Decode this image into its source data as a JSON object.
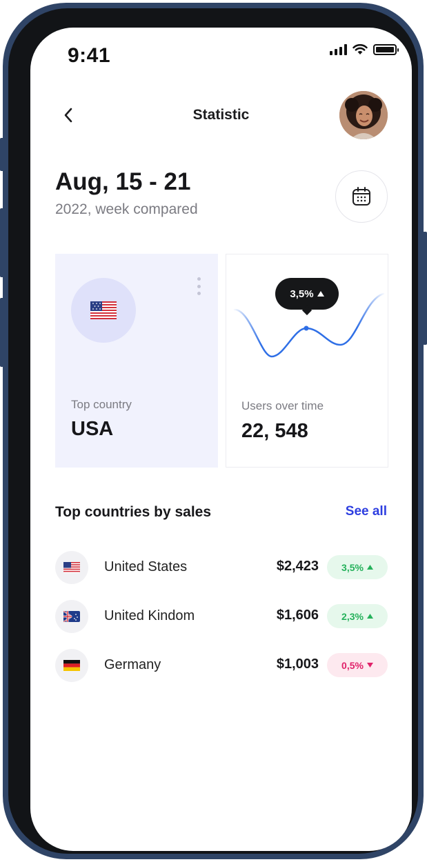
{
  "status_bar": {
    "time": "9:41"
  },
  "header": {
    "title": "Statistic"
  },
  "date": {
    "range": "Aug, 15 - 21",
    "subtitle": "2022, week compared"
  },
  "cards": {
    "top_country": {
      "label": "Top country",
      "value": "USA",
      "flag": "us-flag-icon"
    },
    "users": {
      "label": "Users over time",
      "value": "22, 548",
      "tooltip": "3,5%",
      "tooltip_trend": "up",
      "line_color": "#2f6fe6"
    }
  },
  "section": {
    "title": "Top countries by sales",
    "see_all": "See all"
  },
  "countries": [
    {
      "name": "United States",
      "amount": "$2,423",
      "change": "3,5%",
      "trend": "up",
      "flag": "us-flag-icon"
    },
    {
      "name": "United Kindom",
      "amount": "$1,606",
      "change": "2,3%",
      "trend": "up",
      "flag": "uk-flag-icon"
    },
    {
      "name": "Germany",
      "amount": "$1,003",
      "change": "0,5%",
      "trend": "down",
      "flag": "germany-flag-icon"
    }
  ],
  "colors": {
    "accent": "#2d3ee0",
    "positive": "#25b15b",
    "negative": "#e0226a",
    "card_bg": "#f1f2fd",
    "frame": "#2f4466"
  }
}
